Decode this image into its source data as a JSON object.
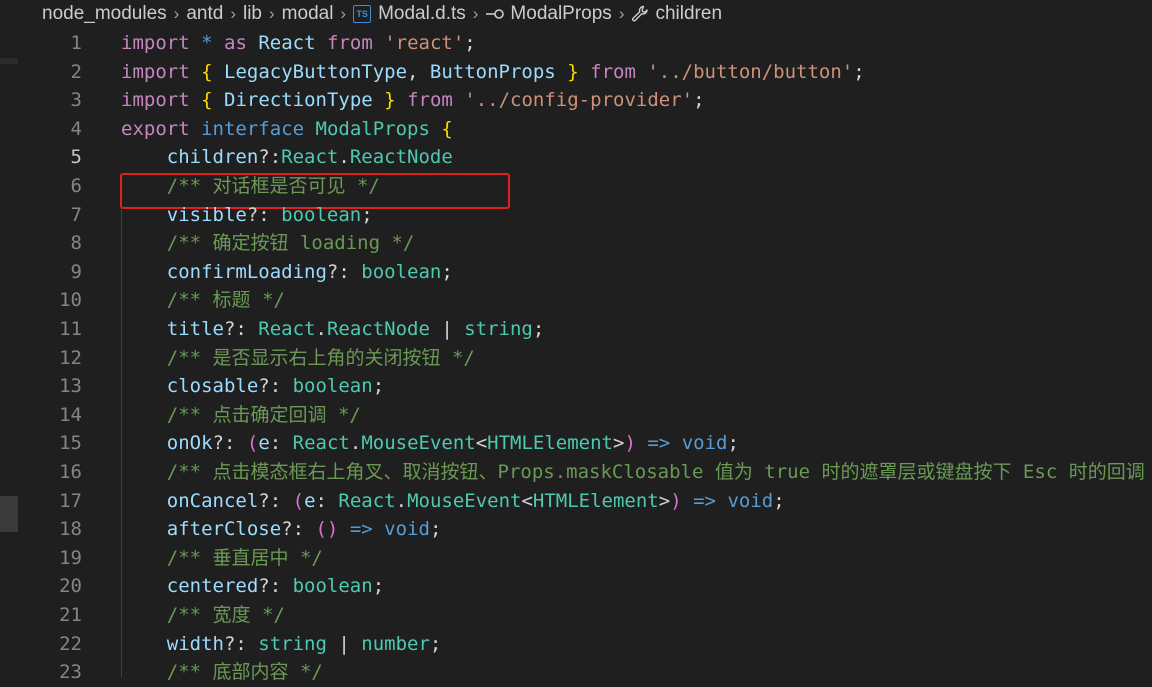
{
  "breadcrumb": {
    "items": [
      "node_modules",
      "antd",
      "lib",
      "modal",
      "Modal.d.ts",
      "ModalProps",
      "children"
    ],
    "file_icon_label": "TS"
  },
  "editor": {
    "active_line": 5,
    "lines": [
      {
        "n": "1",
        "tokens": [
          [
            "kw",
            "import"
          ],
          [
            "pl",
            " "
          ],
          [
            "st",
            "*"
          ],
          [
            "pl",
            " "
          ],
          [
            "kw",
            "as"
          ],
          [
            "pl",
            " "
          ],
          [
            "pr",
            "React"
          ],
          [
            "pl",
            " "
          ],
          [
            "kw",
            "from"
          ],
          [
            "pl",
            " "
          ],
          [
            "str",
            "'react'"
          ],
          [
            "pl",
            ";"
          ]
        ]
      },
      {
        "n": "2",
        "tokens": [
          [
            "kw",
            "import"
          ],
          [
            "pl",
            " "
          ],
          [
            "b1",
            "{"
          ],
          [
            "pl",
            " "
          ],
          [
            "pr",
            "LegacyButtonType"
          ],
          [
            "pl",
            ", "
          ],
          [
            "pr",
            "ButtonProps"
          ],
          [
            "pl",
            " "
          ],
          [
            "b1",
            "}"
          ],
          [
            "pl",
            " "
          ],
          [
            "kw",
            "from"
          ],
          [
            "pl",
            " "
          ],
          [
            "str",
            "'../button/button'"
          ],
          [
            "pl",
            ";"
          ]
        ]
      },
      {
        "n": "3",
        "tokens": [
          [
            "kw",
            "import"
          ],
          [
            "pl",
            " "
          ],
          [
            "b1",
            "{"
          ],
          [
            "pl",
            " "
          ],
          [
            "pr",
            "DirectionType"
          ],
          [
            "pl",
            " "
          ],
          [
            "b1",
            "}"
          ],
          [
            "pl",
            " "
          ],
          [
            "kw",
            "from"
          ],
          [
            "pl",
            " "
          ],
          [
            "str",
            "'../config-provider'"
          ],
          [
            "pl",
            ";"
          ]
        ]
      },
      {
        "n": "4",
        "tokens": [
          [
            "kw",
            "export"
          ],
          [
            "pl",
            " "
          ],
          [
            "st",
            "interface"
          ],
          [
            "pl",
            " "
          ],
          [
            "ty",
            "ModalProps"
          ],
          [
            "pl",
            " "
          ],
          [
            "b1",
            "{"
          ]
        ]
      },
      {
        "n": "5",
        "tokens": [
          [
            "pl",
            "    "
          ],
          [
            "pr",
            "children"
          ],
          [
            "pl",
            "?:"
          ],
          [
            "ty",
            "React"
          ],
          [
            "pl",
            "."
          ],
          [
            "ty",
            "ReactNode"
          ]
        ]
      },
      {
        "n": "6",
        "tokens": [
          [
            "pl",
            "    "
          ],
          [
            "cm",
            "/** 对话框是否可见 */"
          ]
        ]
      },
      {
        "n": "7",
        "tokens": [
          [
            "pl",
            "    "
          ],
          [
            "pr",
            "visible"
          ],
          [
            "pl",
            "?: "
          ],
          [
            "ty",
            "boolean"
          ],
          [
            "pl",
            ";"
          ]
        ]
      },
      {
        "n": "8",
        "tokens": [
          [
            "pl",
            "    "
          ],
          [
            "cm",
            "/** 确定按钮 loading */"
          ]
        ]
      },
      {
        "n": "9",
        "tokens": [
          [
            "pl",
            "    "
          ],
          [
            "pr",
            "confirmLoading"
          ],
          [
            "pl",
            "?: "
          ],
          [
            "ty",
            "boolean"
          ],
          [
            "pl",
            ";"
          ]
        ]
      },
      {
        "n": "10",
        "tokens": [
          [
            "pl",
            "    "
          ],
          [
            "cm",
            "/** 标题 */"
          ]
        ]
      },
      {
        "n": "11",
        "tokens": [
          [
            "pl",
            "    "
          ],
          [
            "pr",
            "title"
          ],
          [
            "pl",
            "?: "
          ],
          [
            "ty",
            "React"
          ],
          [
            "pl",
            "."
          ],
          [
            "ty",
            "ReactNode"
          ],
          [
            "pl",
            " | "
          ],
          [
            "ty",
            "string"
          ],
          [
            "pl",
            ";"
          ]
        ]
      },
      {
        "n": "12",
        "tokens": [
          [
            "pl",
            "    "
          ],
          [
            "cm",
            "/** 是否显示右上角的关闭按钮 */"
          ]
        ]
      },
      {
        "n": "13",
        "tokens": [
          [
            "pl",
            "    "
          ],
          [
            "pr",
            "closable"
          ],
          [
            "pl",
            "?: "
          ],
          [
            "ty",
            "boolean"
          ],
          [
            "pl",
            ";"
          ]
        ]
      },
      {
        "n": "14",
        "tokens": [
          [
            "pl",
            "    "
          ],
          [
            "cm",
            "/** 点击确定回调 */"
          ]
        ]
      },
      {
        "n": "15",
        "tokens": [
          [
            "pl",
            "    "
          ],
          [
            "pr",
            "onOk"
          ],
          [
            "pl",
            "?: "
          ],
          [
            "b2",
            "("
          ],
          [
            "pr",
            "e"
          ],
          [
            "pl",
            ": "
          ],
          [
            "ty",
            "React"
          ],
          [
            "pl",
            "."
          ],
          [
            "ty",
            "MouseEvent"
          ],
          [
            "pl",
            "<"
          ],
          [
            "ty",
            "HTMLElement"
          ],
          [
            "pl",
            ">"
          ],
          [
            "b2",
            ")"
          ],
          [
            "pl",
            " "
          ],
          [
            "st",
            "=>"
          ],
          [
            "pl",
            " "
          ],
          [
            "st",
            "void"
          ],
          [
            "pl",
            ";"
          ]
        ]
      },
      {
        "n": "16",
        "tokens": [
          [
            "pl",
            "    "
          ],
          [
            "cm",
            "/** 点击模态框右上角叉、取消按钮、Props.maskClosable 值为 true 时的遮罩层或键盘按下 Esc 时的回调 */"
          ]
        ]
      },
      {
        "n": "17",
        "tokens": [
          [
            "pl",
            "    "
          ],
          [
            "pr",
            "onCancel"
          ],
          [
            "pl",
            "?: "
          ],
          [
            "b2",
            "("
          ],
          [
            "pr",
            "e"
          ],
          [
            "pl",
            ": "
          ],
          [
            "ty",
            "React"
          ],
          [
            "pl",
            "."
          ],
          [
            "ty",
            "MouseEvent"
          ],
          [
            "pl",
            "<"
          ],
          [
            "ty",
            "HTMLElement"
          ],
          [
            "pl",
            ">"
          ],
          [
            "b2",
            ")"
          ],
          [
            "pl",
            " "
          ],
          [
            "st",
            "=>"
          ],
          [
            "pl",
            " "
          ],
          [
            "st",
            "void"
          ],
          [
            "pl",
            ";"
          ]
        ]
      },
      {
        "n": "18",
        "tokens": [
          [
            "pl",
            "    "
          ],
          [
            "pr",
            "afterClose"
          ],
          [
            "pl",
            "?: "
          ],
          [
            "b2",
            "()"
          ],
          [
            "pl",
            " "
          ],
          [
            "st",
            "=>"
          ],
          [
            "pl",
            " "
          ],
          [
            "st",
            "void"
          ],
          [
            "pl",
            ";"
          ]
        ]
      },
      {
        "n": "19",
        "tokens": [
          [
            "pl",
            "    "
          ],
          [
            "cm",
            "/** 垂直居中 */"
          ]
        ]
      },
      {
        "n": "20",
        "tokens": [
          [
            "pl",
            "    "
          ],
          [
            "pr",
            "centered"
          ],
          [
            "pl",
            "?: "
          ],
          [
            "ty",
            "boolean"
          ],
          [
            "pl",
            ";"
          ]
        ]
      },
      {
        "n": "21",
        "tokens": [
          [
            "pl",
            "    "
          ],
          [
            "cm",
            "/** 宽度 */"
          ]
        ]
      },
      {
        "n": "22",
        "tokens": [
          [
            "pl",
            "    "
          ],
          [
            "pr",
            "width"
          ],
          [
            "pl",
            "?: "
          ],
          [
            "ty",
            "string"
          ],
          [
            "pl",
            " | "
          ],
          [
            "ty",
            "number"
          ],
          [
            "pl",
            ";"
          ]
        ]
      },
      {
        "n": "23",
        "tokens": [
          [
            "pl",
            "    "
          ],
          [
            "cm",
            "/** 底部内容 */"
          ]
        ]
      }
    ]
  },
  "colors": {
    "background": "#1f1f1f",
    "highlight_border": "#e0201e",
    "keyword": "#c586c0",
    "storage": "#569cd6",
    "type": "#4ec9b0",
    "property": "#9cdcfe",
    "string": "#ce9178",
    "comment": "#6a9955"
  }
}
